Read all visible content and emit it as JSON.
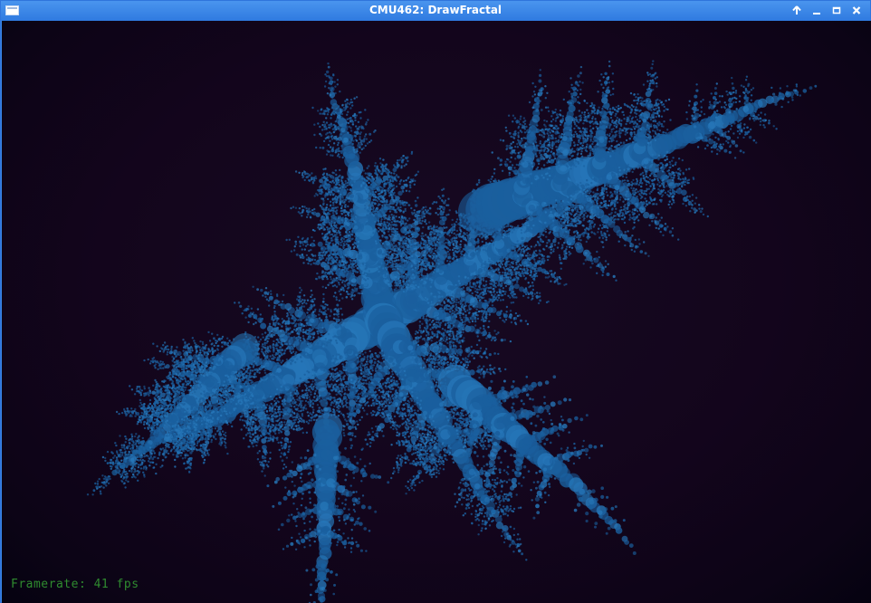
{
  "window": {
    "title": "CMU462: DrawFractal"
  },
  "controls": {
    "stick_icon": "arrow-up-icon",
    "minimize_icon": "minimize-icon",
    "maximize_icon": "maximize-icon",
    "close_icon": "close-icon"
  },
  "overlay": {
    "framerate_text": "Framerate: 41 fps"
  },
  "colors": {
    "titlebar": "#3a86e6",
    "background": "#13051c",
    "fractal": "#1a5f9e",
    "fractal_highlight": "#2676b8",
    "framerate_text": "#2f8b2f"
  }
}
